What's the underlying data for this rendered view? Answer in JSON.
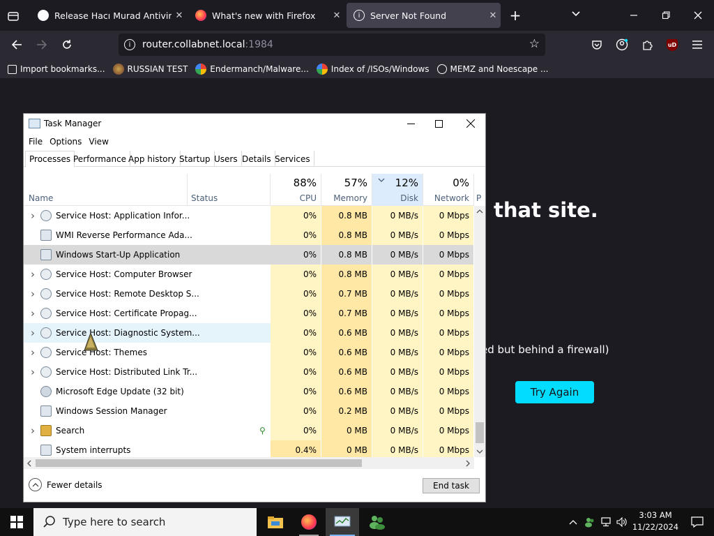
{
  "browser": {
    "tabs": [
      {
        "title": "Release Hacı Murad Antivirüs B",
        "active": false
      },
      {
        "title": "What's new with Firefox",
        "active": false
      },
      {
        "title": "Server Not Found",
        "active": true
      }
    ],
    "url_host": "router.collabnet.local",
    "url_port": ":1984",
    "bookmarks": [
      "Import bookmarks...",
      "RUSSIAN TEST",
      "Endermanch/Malware...",
      "Index of /ISOs/Windows",
      "MEMZ and Noescape ..."
    ]
  },
  "page": {
    "title_fragment": "that site.",
    "text_fragment": "ed but behind a firewall)",
    "try_again": "Try Again"
  },
  "taskmanager": {
    "title": "Task Manager",
    "menu": [
      "File",
      "Options",
      "View"
    ],
    "tabs": [
      "Processes",
      "Performance",
      "App history",
      "Startup",
      "Users",
      "Details",
      "Services"
    ],
    "columns": {
      "name": "Name",
      "status": "Status",
      "cpu": {
        "pct": "88%",
        "label": "CPU"
      },
      "memory": {
        "pct": "57%",
        "label": "Memory"
      },
      "disk": {
        "pct": "12%",
        "label": "Disk"
      },
      "network": {
        "pct": "0%",
        "label": "Network"
      },
      "extra": "P"
    },
    "rows": [
      {
        "name": "Service Host: Application Infor...",
        "expand": true,
        "cpu": "0%",
        "mem": "0.8 MB",
        "disk": "0 MB/s",
        "net": "0 Mbps",
        "icon": "gear-icon"
      },
      {
        "name": "WMI Reverse Performance Ada...",
        "expand": false,
        "cpu": "0%",
        "mem": "0.8 MB",
        "disk": "0 MB/s",
        "net": "0 Mbps",
        "icon": "window-icon"
      },
      {
        "name": "Windows Start-Up Application",
        "expand": false,
        "cpu": "0%",
        "mem": "0.8 MB",
        "disk": "0 MB/s",
        "net": "0 Mbps",
        "icon": "window-icon",
        "selected": true
      },
      {
        "name": "Service Host: Computer Browser",
        "expand": true,
        "cpu": "0%",
        "mem": "0.8 MB",
        "disk": "0 MB/s",
        "net": "0 Mbps",
        "icon": "gear-icon"
      },
      {
        "name": "Service Host: Remote Desktop S...",
        "expand": true,
        "cpu": "0%",
        "mem": "0.7 MB",
        "disk": "0 MB/s",
        "net": "0 Mbps",
        "icon": "gear-icon"
      },
      {
        "name": "Service Host: Certificate Propag...",
        "expand": true,
        "cpu": "0%",
        "mem": "0.7 MB",
        "disk": "0 MB/s",
        "net": "0 Mbps",
        "icon": "gear-icon"
      },
      {
        "name": "Service Host: Diagnostic System...",
        "expand": true,
        "cpu": "0%",
        "mem": "0.6 MB",
        "disk": "0 MB/s",
        "net": "0 Mbps",
        "icon": "gear-icon",
        "hover": true
      },
      {
        "name": "Service Host: Themes",
        "expand": true,
        "cpu": "0%",
        "mem": "0.6 MB",
        "disk": "0 MB/s",
        "net": "0 Mbps",
        "icon": "gear-icon"
      },
      {
        "name": "Service Host: Distributed Link Tr...",
        "expand": true,
        "cpu": "0%",
        "mem": "0.6 MB",
        "disk": "0 MB/s",
        "net": "0 Mbps",
        "icon": "gear-icon"
      },
      {
        "name": "Microsoft Edge Update (32 bit)",
        "expand": false,
        "cpu": "0%",
        "mem": "0.6 MB",
        "disk": "0 MB/s",
        "net": "0 Mbps",
        "icon": "update-icon"
      },
      {
        "name": "Windows Session Manager",
        "expand": false,
        "cpu": "0%",
        "mem": "0.2 MB",
        "disk": "0 MB/s",
        "net": "0 Mbps",
        "icon": "window-icon"
      },
      {
        "name": "Search",
        "expand": true,
        "cpu": "0%",
        "mem": "0 MB",
        "disk": "0 MB/s",
        "net": "0 Mbps",
        "icon": "search-icon",
        "status_icon": "leaf-icon"
      },
      {
        "name": "System interrupts",
        "expand": false,
        "cpu": "0.4%",
        "mem": "0 MB",
        "disk": "0 MB/s",
        "net": "0 Mbps",
        "icon": "window-icon"
      }
    ],
    "fewer_details": "Fewer details",
    "end_task": "End task"
  },
  "taskbar": {
    "search_placeholder": "Type here to search",
    "time": "3:03 AM",
    "date": "11/22/2024"
  },
  "colors": {
    "accent_cyan": "#00ddff",
    "cpu_col": "#fff4c4",
    "mem_col": "#ffe8a6",
    "disk_col": "#fff4c4",
    "net_col": "#fff4c4"
  }
}
